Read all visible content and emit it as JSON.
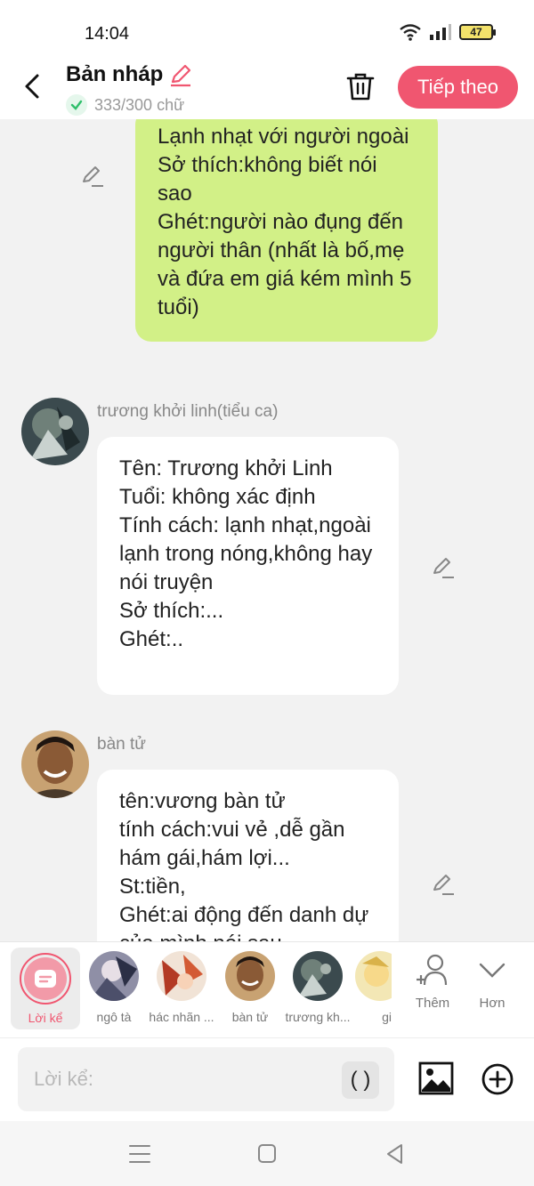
{
  "status_bar": {
    "time": "14:04",
    "battery": "47"
  },
  "header": {
    "title": "Bản nháp",
    "word_count": "333/300 chữ",
    "next_label": "Tiếp theo"
  },
  "messages": {
    "m1": {
      "text": "Lạnh nhạt với người ngoài\nSở thích:không biết nói sao\nGhét:người nào đụng đến người thân (nhất là bố,mẹ và đứa em giá kém mình 5 tuổi)"
    },
    "m2": {
      "name": "trương khởi linh(tiểu ca)",
      "text": "Tên: Trương khởi Linh\nTuổi: không xác định\nTính cách: lạnh nhạt,ngoài lạnh trong nóng,không hay nói truyện\nSở thích:...\nGhét:.."
    },
    "m3": {
      "name": "bàn tử",
      "text": "tên:vương bàn tử\ntính cách:vui vẻ ,dễ gần hám gái,hám lợi...\nSt:tiền,\nGhét:ai động đến danh dự của mình,nói sau"
    }
  },
  "characters": {
    "narrator": "Lời kể",
    "c1": "ngô tà",
    "c2": "hác nhãn ...",
    "c3": "bàn tử",
    "c4": "trương kh...",
    "c5": "gi",
    "more": "Thêm",
    "more2": "Hơn"
  },
  "input": {
    "placeholder": "Lời kể:",
    "paren": "( )"
  },
  "colors": {
    "accent": "#f05670",
    "green_bubble": "#d2f087",
    "check": "#2fbf6b"
  }
}
